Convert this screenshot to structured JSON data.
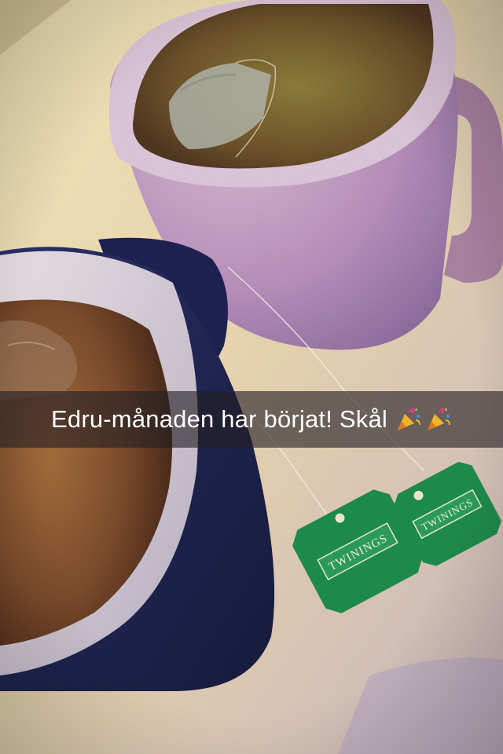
{
  "snap": {
    "caption": "Edru-månaden har börjat! Skål",
    "caption_emojis": [
      "party-popper-icon",
      "party-popper-icon"
    ],
    "tea_tag_brand": "TWININGS"
  },
  "colors": {
    "caption_bar": "#231e23",
    "tag_green": "#1f8a4a",
    "mug_pink": "#b98fb7",
    "mug_navy": "#1d2350",
    "table": "#e3d2ad",
    "tea": "#8a5a2e"
  }
}
